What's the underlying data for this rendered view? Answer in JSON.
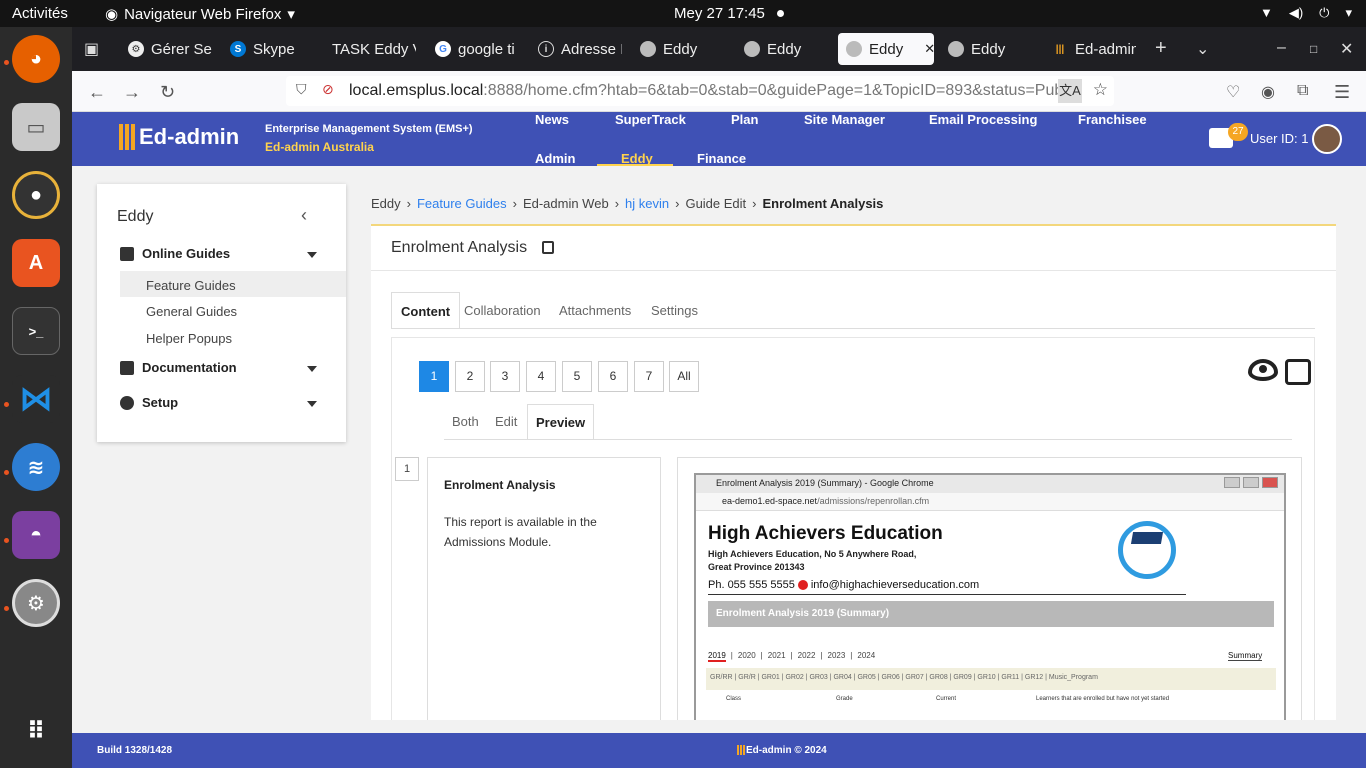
{
  "os": {
    "activities": "Activités",
    "app_name": "Navigateur Web Firefox",
    "clock": "Mey 27  17:45"
  },
  "tabs": [
    {
      "label": "Gérer Se"
    },
    {
      "label": "Skype"
    },
    {
      "label": "TASK Eddy V"
    },
    {
      "label": "google ti"
    },
    {
      "label": "Adresse I"
    },
    {
      "label": "Eddy"
    },
    {
      "label": "Eddy"
    },
    {
      "label": "Eddy"
    },
    {
      "label": "Eddy"
    },
    {
      "label": "Ed-admin"
    }
  ],
  "url": {
    "domain": "local.emsplus.local",
    "rest": ":8888/home.cfm?htab=6&tab=0&stab=0&guidePage=1&TopicID=893&status=Publ"
  },
  "header": {
    "brand": "Ed-admin",
    "system": "Enterprise Management System (EMS+)",
    "org": "Ed-admin Australia",
    "nav_row1": [
      "News",
      "SuperTrack",
      "Plan",
      "Site Manager",
      "Email Processing",
      "Franchisee"
    ],
    "nav_row2": [
      "Admin",
      "Eddy",
      "Finance"
    ],
    "badge": "27",
    "user": "User ID: 1"
  },
  "sidebar": {
    "title": "Eddy",
    "sections": [
      "Online Guides",
      "Documentation",
      "Setup"
    ],
    "items": [
      "Feature Guides",
      "General Guides",
      "Helper Popups"
    ]
  },
  "breadcrumb": [
    "Eddy",
    "Feature Guides",
    "Ed-admin Web",
    "hj kevin",
    "Guide Edit",
    "Enrolment Analysis"
  ],
  "panel": {
    "title": "Enrolment Analysis",
    "tabs": [
      "Content",
      "Collaboration",
      "Attachments",
      "Settings"
    ],
    "pages": [
      "1",
      "2",
      "3",
      "4",
      "5",
      "6",
      "7",
      "All"
    ],
    "modes": [
      "Both",
      "Edit",
      "Preview"
    ],
    "step": "1",
    "step_title": "Enrolment Analysis",
    "step_text": "This report is available in the Admissions Module."
  },
  "screenshot": {
    "window_title": "Enrolment Analysis 2019 (Summary) - Google Chrome",
    "url_domain": "ea-demo1.ed-space.net",
    "url_path": "/admissions/repenrollan.cfm",
    "school": "High Achievers Education",
    "address1": "High Achievers Education, No 5 Anywhere Road,",
    "address2": "Great Province 201343",
    "phone": "Ph. 055 555 5555",
    "email": "info@highachieverseducation.com",
    "report": "Enrolment Analysis 2019 (Summary)",
    "years": [
      "2019",
      "2020",
      "2021",
      "2022",
      "2023",
      "2024"
    ],
    "summary": "Summary",
    "grades": "GR/RR  |  GR/R  |  GR01  |  GR02  |  GR03  |  GR04  |  GR05  |  GR06  |  GR07  |  GR08  |  GR09  |  GR10  |  GR11  |  GR12  |  Music_Program",
    "col_class": "Class",
    "col_grade": "Grade",
    "col_current": "Current",
    "col_pending": "Learners that are enrolled but have not yet started"
  },
  "footer": {
    "build": "Build 1328/1428",
    "copyright": "Ed-admin  © 2024"
  }
}
